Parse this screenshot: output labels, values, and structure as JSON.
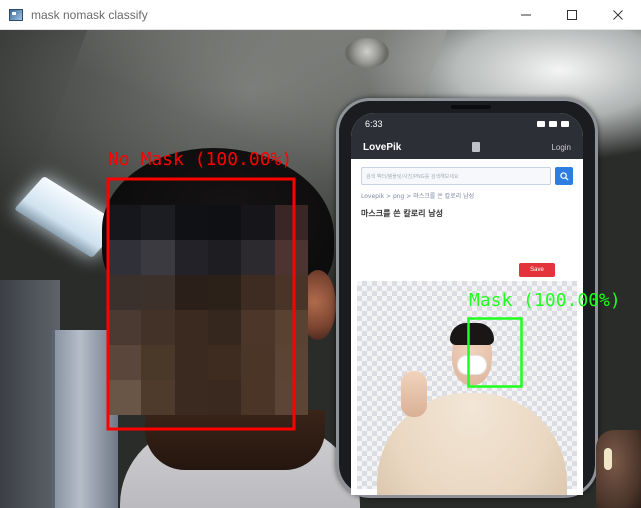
{
  "window": {
    "title": "mask nomask classify",
    "controls": {
      "minimize": "minimize-icon",
      "maximize": "maximize-icon",
      "close": "close-icon"
    }
  },
  "detections": [
    {
      "label": "No Mask (100.00%)",
      "color": "#ff0000"
    },
    {
      "label": "Mask (100.00%)",
      "color": "#1dff1d"
    }
  ],
  "phone": {
    "time": "6:33",
    "site_logo": "LovePik",
    "login": "Login",
    "search_text": "검색 벡터/템플릿/사진/PNG를 검색해보세요",
    "breadcrumb": "Lovepik > png > 마스크를 쓴 칼로리 남성",
    "heading": "마스크를 쓴 칼로리 남성",
    "save_label": "Save"
  },
  "colors": {
    "no_mask": "#ff0000",
    "mask": "#1dff1d",
    "site_header": "#2d2f36",
    "save_button": "#e3343b",
    "search_button": "#2f7de1"
  }
}
